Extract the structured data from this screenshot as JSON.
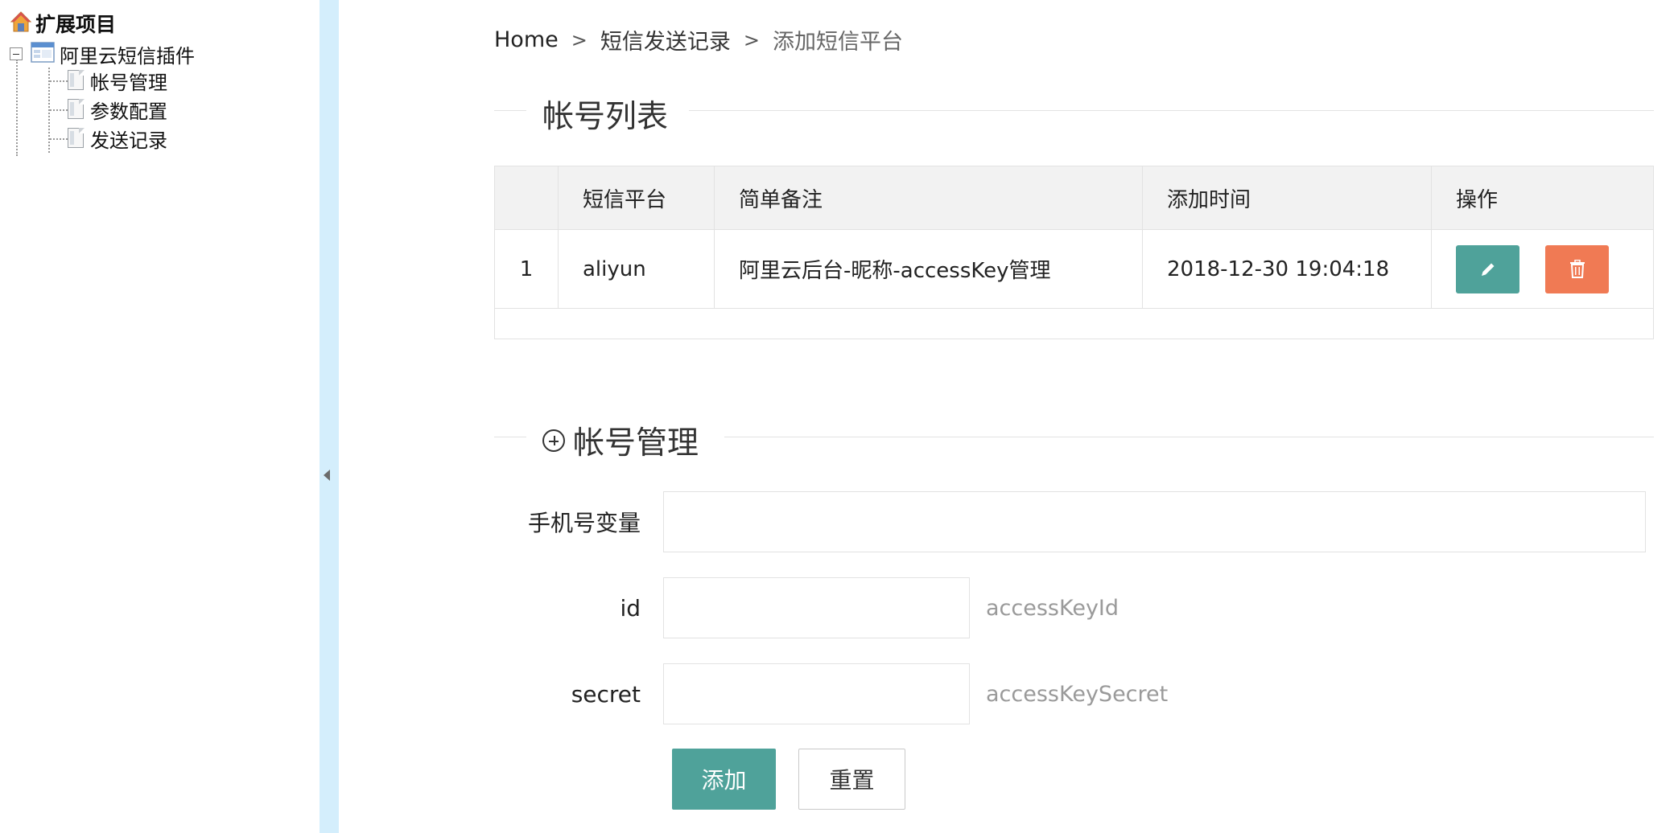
{
  "sidebar": {
    "root_label": "扩展项目",
    "folder_label": "阿里云短信插件",
    "items": [
      {
        "label": "帐号管理"
      },
      {
        "label": "参数配置"
      },
      {
        "label": "发送记录"
      }
    ]
  },
  "breadcrumb": {
    "home": "Home",
    "separator": ">",
    "level1": "短信发送记录",
    "current": "添加短信平台"
  },
  "list_section": {
    "title": "帐号列表"
  },
  "table": {
    "headers": [
      "",
      "短信平台",
      "简单备注",
      "添加时间",
      "操作"
    ],
    "rows": [
      {
        "index": "1",
        "platform": "aliyun",
        "note": "阿里云后台-昵称-accessKey管理",
        "time": "2018-12-30 19:04:18"
      }
    ]
  },
  "form_section": {
    "title": "帐号管理"
  },
  "form": {
    "phone_label": "手机号变量",
    "phone_value": "",
    "id_label": "id",
    "id_value": "",
    "id_hint": "accessKeyId",
    "secret_label": "secret",
    "secret_value": "",
    "secret_hint": "accessKeySecret",
    "submit_label": "添加",
    "reset_label": "重置"
  },
  "colors": {
    "accent": "#4fa29a",
    "danger": "#f07a54",
    "splitter": "#d4eefc"
  },
  "icons": {
    "root": "home-icon",
    "folder": "window-icon",
    "leaf": "document-icon",
    "edit": "pencil-icon",
    "delete": "trash-icon",
    "section_add": "plus-circle-icon",
    "collapse": "triangle-left-icon"
  }
}
